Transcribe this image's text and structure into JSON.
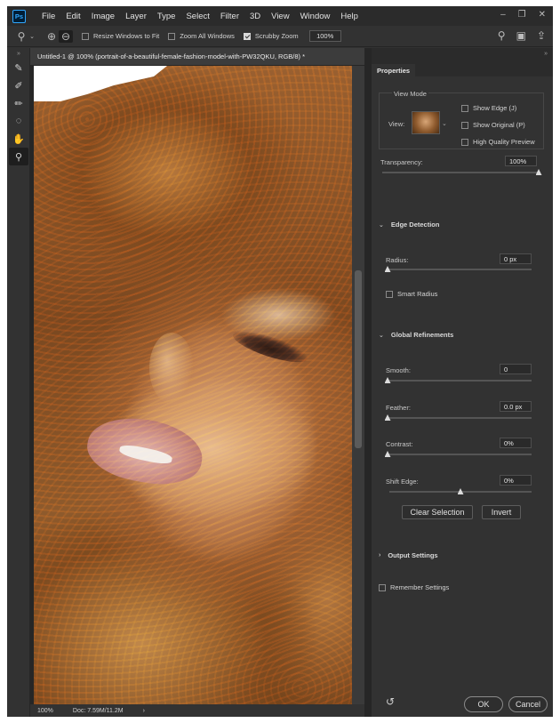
{
  "app": {
    "logo": "Ps"
  },
  "menu": [
    "File",
    "Edit",
    "Image",
    "Layer",
    "Type",
    "Select",
    "Filter",
    "3D",
    "View",
    "Window",
    "Help"
  ],
  "options_bar": {
    "resize_windows": "Resize Windows to Fit",
    "zoom_all": "Zoom All Windows",
    "scrubby_zoom": "Scrubby Zoom",
    "zoom_value": "100%"
  },
  "document": {
    "tab_title": "Untitled-1 @ 100% (portrait-of-a-beautiful-female-fashion-model-with-PW32QKU, RGB/8) *",
    "status_zoom": "100%",
    "status_doc": "Doc: 7.59M/11.2M"
  },
  "panel": {
    "tab": "Properties",
    "view_mode": {
      "title": "View Mode",
      "view_label": "View:",
      "show_edge": "Show Edge (J)",
      "show_original": "Show Original (P)",
      "high_quality": "High Quality Preview"
    },
    "transparency": {
      "label": "Transparency:",
      "value": "100%",
      "level": 1.0
    },
    "edge_detection": {
      "title": "Edge Detection",
      "radius_label": "Radius:",
      "radius_value": "0 px",
      "radius_level": 0.0,
      "smart_radius": "Smart Radius"
    },
    "global_refinements": {
      "title": "Global Refinements",
      "smooth_label": "Smooth:",
      "smooth_value": "0",
      "smooth_level": 0.0,
      "feather_label": "Feather:",
      "feather_value": "0.0 px",
      "feather_level": 0.0,
      "contrast_label": "Contrast:",
      "contrast_value": "0%",
      "contrast_level": 0.0,
      "shift_label": "Shift Edge:",
      "shift_value": "0%",
      "shift_level": 0.5
    },
    "clear_selection": "Clear Selection",
    "invert": "Invert",
    "output_settings": "Output Settings",
    "remember_settings": "Remember Settings",
    "ok": "OK",
    "cancel": "Cancel"
  }
}
